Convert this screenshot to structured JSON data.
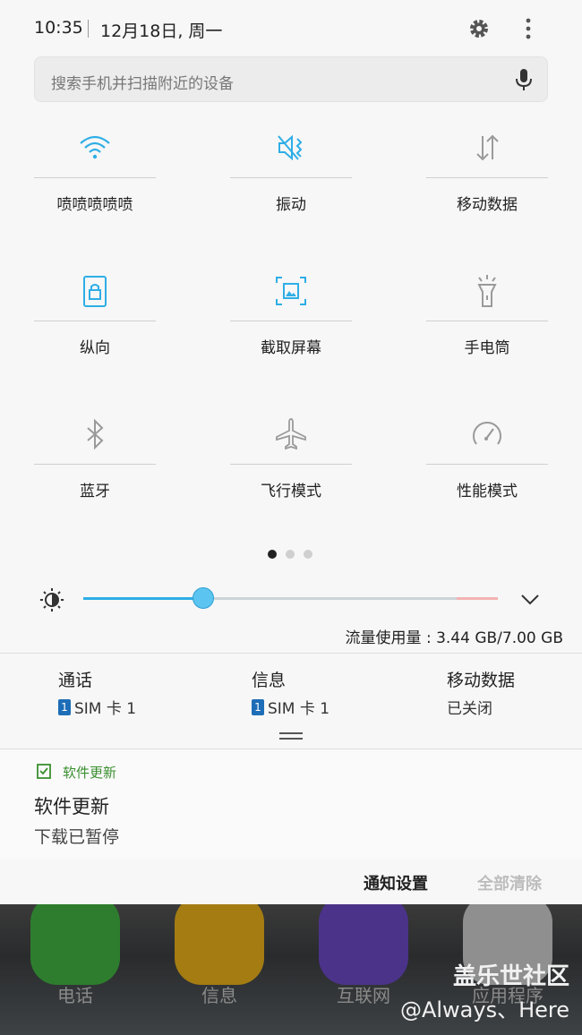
{
  "status": {
    "time": "10:35",
    "date": "12月18日, 周一"
  },
  "search": {
    "placeholder": "搜索手机并扫描附近的设备"
  },
  "tiles": [
    {
      "label": "喷喷喷喷喷",
      "icon": "wifi-icon",
      "active": true
    },
    {
      "label": "振动",
      "icon": "vibrate-icon",
      "active": true
    },
    {
      "label": "移动数据",
      "icon": "mobile-data-icon",
      "active": false
    },
    {
      "label": "纵向",
      "icon": "portrait-lock-icon",
      "active": true
    },
    {
      "label": "截取屏幕",
      "icon": "screenshot-icon",
      "active": true
    },
    {
      "label": "手电筒",
      "icon": "flashlight-icon",
      "active": false
    },
    {
      "label": "蓝牙",
      "icon": "bluetooth-icon",
      "active": false
    },
    {
      "label": "飞行模式",
      "icon": "airplane-icon",
      "active": false
    },
    {
      "label": "性能模式",
      "icon": "performance-icon",
      "active": false
    }
  ],
  "page_indicator": {
    "count": 3,
    "current": 1
  },
  "brightness": {
    "level": 0.29
  },
  "data_usage": "流量使用量 : 3.44 GB/7.00 GB",
  "sim": [
    {
      "title": "通话",
      "sub": "SIM 卡 1",
      "badge": "1"
    },
    {
      "title": "信息",
      "sub": "SIM 卡 1",
      "badge": "1"
    },
    {
      "title": "移动数据",
      "sub": "已关闭",
      "badge": ""
    }
  ],
  "notification": {
    "app": "软件更新",
    "title": "软件更新",
    "body": "下载已暂停"
  },
  "actions": {
    "settings": "通知设置",
    "clear_all": "全部清除"
  },
  "home": {
    "apps": [
      {
        "label": "电话",
        "color": "#3aa53a"
      },
      {
        "label": "信息",
        "color": "#d8a518"
      },
      {
        "label": "互联网",
        "color": "#5c3fa8"
      },
      {
        "label": "应用程序",
        "color": "#bbbbbb"
      }
    ],
    "watermark": "盖乐世社区",
    "watermark_user": "@Always、Here"
  },
  "colors": {
    "accent": "#2eaee6",
    "inactive_icon": "#9a9a9a",
    "notif_app": "#3a8f2f"
  }
}
